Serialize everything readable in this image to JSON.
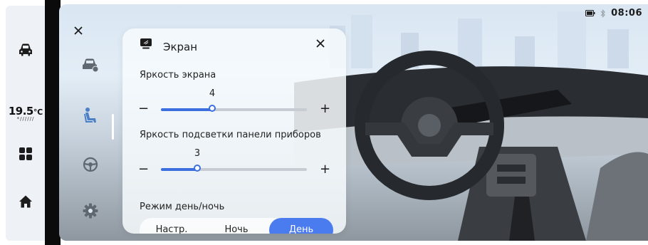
{
  "status": {
    "time": "08:06"
  },
  "dock": {
    "temperature": "19.5",
    "temperature_unit": "℃",
    "temperature_sub": "*//////"
  },
  "panel": {
    "title": "Экран",
    "brightness": {
      "label": "Яркость экрана",
      "value": "4",
      "level": 0.35
    },
    "backlight": {
      "label": "Яркость подсветки панели приборов",
      "value": "3",
      "level": 0.25
    },
    "daynight": {
      "label": "Режим день/ночь",
      "options": [
        "Настр.",
        "Ночь",
        "День"
      ],
      "selected": "День"
    }
  },
  "colors": {
    "accent": "#3b6fe0",
    "active_segment": "#4a7cf0"
  }
}
